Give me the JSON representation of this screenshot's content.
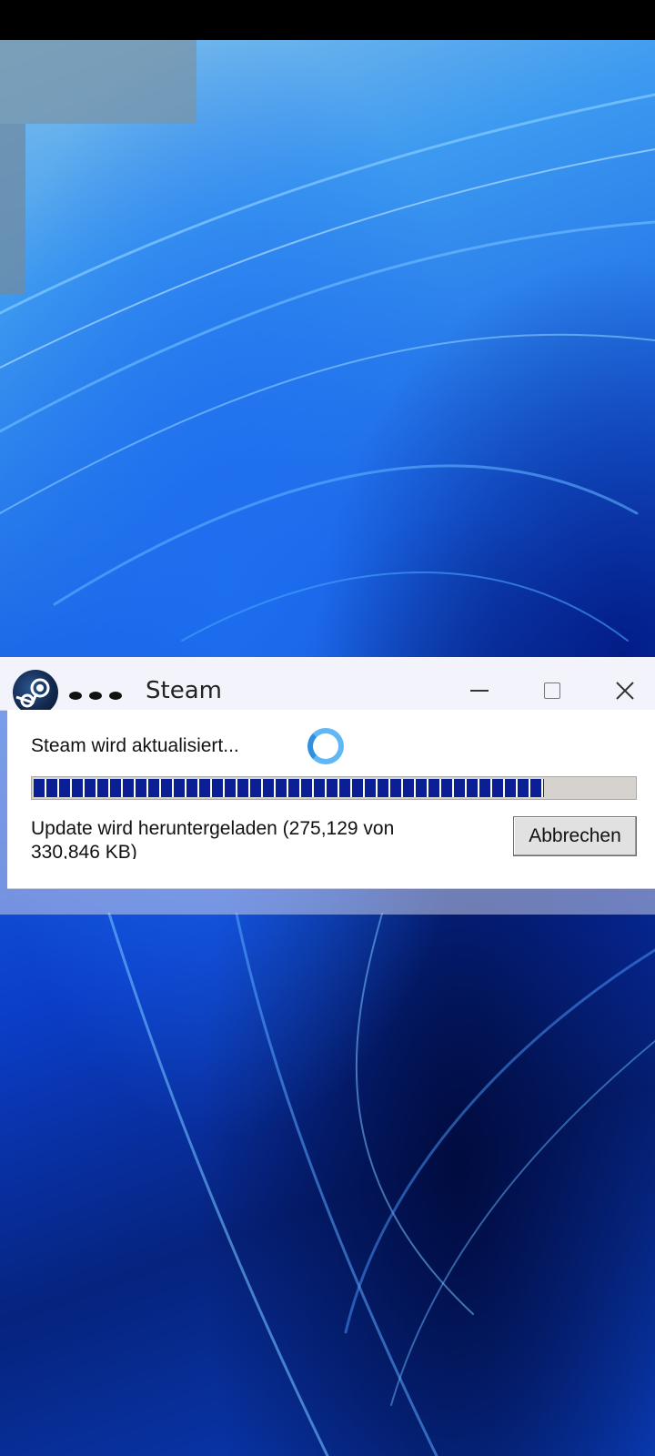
{
  "window": {
    "title": "Steam",
    "menu_dots": "•••"
  },
  "dialog": {
    "status": "Steam wird aktualisiert...",
    "download_status": "Update wird heruntergeladen (275,129 von 330,846 KB)",
    "progress_fraction": 0.85,
    "cancel_label": "Abbrechen"
  },
  "icons": {
    "app": "steam-logo-icon",
    "minimize": "minimize-icon",
    "maximize": "maximize-icon",
    "close": "close-icon",
    "spinner": "loading-spinner-icon"
  },
  "colors": {
    "progress_fill": "#0a1f96",
    "progress_track": "#d6d3ce",
    "spinner": "#5fb7f3"
  }
}
